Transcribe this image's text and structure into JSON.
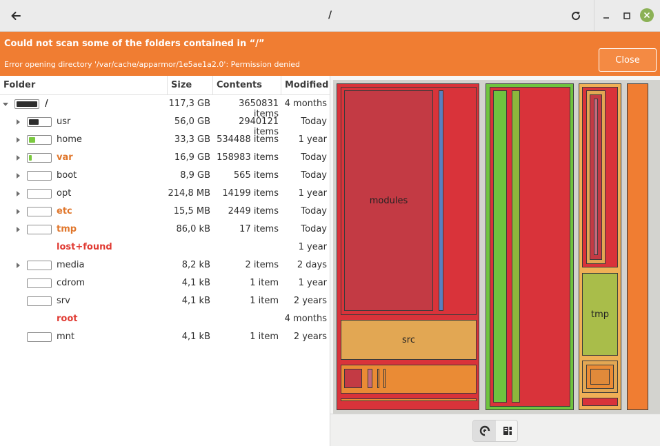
{
  "header": {
    "title": "/"
  },
  "infobar": {
    "title": "Could not scan some of the folders contained in “/”",
    "message": "Error opening directory '/var/cache/apparmor/1e5ae1a2.0': Permission denied",
    "close_label": "Close"
  },
  "table": {
    "columns": {
      "folder": "Folder",
      "size": "Size",
      "contents": "Contents",
      "modified": "Modified"
    },
    "rows": [
      {
        "name": "/",
        "size": "117,3 GB",
        "contents": "3650831 items",
        "modified": "4 months",
        "fill": 1.0,
        "expander": "expanded",
        "status": "normal"
      },
      {
        "name": "usr",
        "size": "56,0 GB",
        "contents": "2940121 items",
        "modified": "Today",
        "fill": 0.477,
        "expander": "collapsed",
        "status": "normal"
      },
      {
        "name": "home",
        "size": "33,3 GB",
        "contents": "534488 items",
        "modified": "1 year",
        "fill": 0.284,
        "expander": "collapsed",
        "status": "normal"
      },
      {
        "name": "var",
        "size": "16,9 GB",
        "contents": "158983 items",
        "modified": "Today",
        "fill": 0.144,
        "expander": "collapsed",
        "status": "warn"
      },
      {
        "name": "boot",
        "size": "8,9 GB",
        "contents": "565 items",
        "modified": "Today",
        "fill": 0.0,
        "expander": "collapsed",
        "status": "normal"
      },
      {
        "name": "opt",
        "size": "214,8 MB",
        "contents": "14199 items",
        "modified": "1 year",
        "fill": 0.0,
        "expander": "collapsed",
        "status": "normal"
      },
      {
        "name": "etc",
        "size": "15,5 MB",
        "contents": "2449 items",
        "modified": "Today",
        "fill": 0.0,
        "expander": "collapsed",
        "status": "warn"
      },
      {
        "name": "tmp",
        "size": "86,0 kB",
        "contents": "17 items",
        "modified": "Today",
        "fill": 0.0,
        "expander": "collapsed",
        "status": "warn"
      },
      {
        "name": "lost+found",
        "size": "",
        "contents": "",
        "modified": "1 year",
        "fill": null,
        "expander": "none",
        "status": "error"
      },
      {
        "name": "media",
        "size": "8,2 kB",
        "contents": "2 items",
        "modified": "2 days",
        "fill": 0.0,
        "expander": "collapsed",
        "status": "normal"
      },
      {
        "name": "cdrom",
        "size": "4,1 kB",
        "contents": "1 item",
        "modified": "1 year",
        "fill": 0.0,
        "expander": "none",
        "status": "normal"
      },
      {
        "name": "srv",
        "size": "4,1 kB",
        "contents": "1 item",
        "modified": "2 years",
        "fill": 0.0,
        "expander": "none",
        "status": "normal"
      },
      {
        "name": "root",
        "size": "",
        "contents": "",
        "modified": "4 months",
        "fill": null,
        "expander": "none",
        "status": "error"
      },
      {
        "name": "mnt",
        "size": "4,1 kB",
        "contents": "1 item",
        "modified": "2 years",
        "fill": 0.0,
        "expander": "none",
        "status": "normal"
      }
    ]
  },
  "treemap": {
    "labels": {
      "modules": "modules",
      "src": "src",
      "tmp": "tmp"
    }
  },
  "view_switcher": {
    "active": "treemap-view"
  },
  "colors": {
    "infobar": "#f07d32",
    "error_text": "#e03b33",
    "warn_text": "#e0762b",
    "usage_dark": "#2e2e2e",
    "usage_green": "#7bc940",
    "window_close": "#8bb155"
  }
}
